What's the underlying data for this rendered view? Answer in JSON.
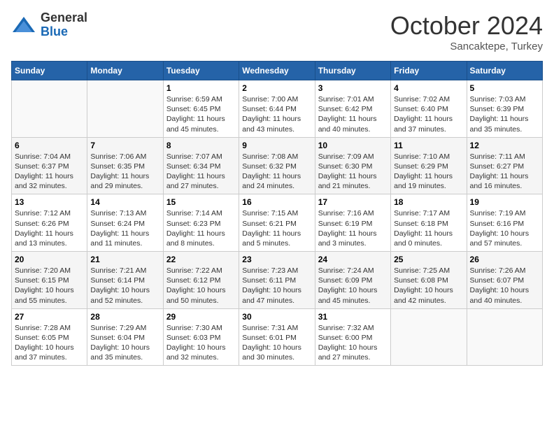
{
  "header": {
    "logo_general": "General",
    "logo_blue": "Blue",
    "month_title": "October 2024",
    "location": "Sancaktepe, Turkey"
  },
  "weekdays": [
    "Sunday",
    "Monday",
    "Tuesday",
    "Wednesday",
    "Thursday",
    "Friday",
    "Saturday"
  ],
  "weeks": [
    [
      {
        "day": "",
        "info": ""
      },
      {
        "day": "",
        "info": ""
      },
      {
        "day": "1",
        "info": "Sunrise: 6:59 AM\nSunset: 6:45 PM\nDaylight: 11 hours and 45 minutes."
      },
      {
        "day": "2",
        "info": "Sunrise: 7:00 AM\nSunset: 6:44 PM\nDaylight: 11 hours and 43 minutes."
      },
      {
        "day": "3",
        "info": "Sunrise: 7:01 AM\nSunset: 6:42 PM\nDaylight: 11 hours and 40 minutes."
      },
      {
        "day": "4",
        "info": "Sunrise: 7:02 AM\nSunset: 6:40 PM\nDaylight: 11 hours and 37 minutes."
      },
      {
        "day": "5",
        "info": "Sunrise: 7:03 AM\nSunset: 6:39 PM\nDaylight: 11 hours and 35 minutes."
      }
    ],
    [
      {
        "day": "6",
        "info": "Sunrise: 7:04 AM\nSunset: 6:37 PM\nDaylight: 11 hours and 32 minutes."
      },
      {
        "day": "7",
        "info": "Sunrise: 7:06 AM\nSunset: 6:35 PM\nDaylight: 11 hours and 29 minutes."
      },
      {
        "day": "8",
        "info": "Sunrise: 7:07 AM\nSunset: 6:34 PM\nDaylight: 11 hours and 27 minutes."
      },
      {
        "day": "9",
        "info": "Sunrise: 7:08 AM\nSunset: 6:32 PM\nDaylight: 11 hours and 24 minutes."
      },
      {
        "day": "10",
        "info": "Sunrise: 7:09 AM\nSunset: 6:30 PM\nDaylight: 11 hours and 21 minutes."
      },
      {
        "day": "11",
        "info": "Sunrise: 7:10 AM\nSunset: 6:29 PM\nDaylight: 11 hours and 19 minutes."
      },
      {
        "day": "12",
        "info": "Sunrise: 7:11 AM\nSunset: 6:27 PM\nDaylight: 11 hours and 16 minutes."
      }
    ],
    [
      {
        "day": "13",
        "info": "Sunrise: 7:12 AM\nSunset: 6:26 PM\nDaylight: 11 hours and 13 minutes."
      },
      {
        "day": "14",
        "info": "Sunrise: 7:13 AM\nSunset: 6:24 PM\nDaylight: 11 hours and 11 minutes."
      },
      {
        "day": "15",
        "info": "Sunrise: 7:14 AM\nSunset: 6:23 PM\nDaylight: 11 hours and 8 minutes."
      },
      {
        "day": "16",
        "info": "Sunrise: 7:15 AM\nSunset: 6:21 PM\nDaylight: 11 hours and 5 minutes."
      },
      {
        "day": "17",
        "info": "Sunrise: 7:16 AM\nSunset: 6:19 PM\nDaylight: 11 hours and 3 minutes."
      },
      {
        "day": "18",
        "info": "Sunrise: 7:17 AM\nSunset: 6:18 PM\nDaylight: 11 hours and 0 minutes."
      },
      {
        "day": "19",
        "info": "Sunrise: 7:19 AM\nSunset: 6:16 PM\nDaylight: 10 hours and 57 minutes."
      }
    ],
    [
      {
        "day": "20",
        "info": "Sunrise: 7:20 AM\nSunset: 6:15 PM\nDaylight: 10 hours and 55 minutes."
      },
      {
        "day": "21",
        "info": "Sunrise: 7:21 AM\nSunset: 6:14 PM\nDaylight: 10 hours and 52 minutes."
      },
      {
        "day": "22",
        "info": "Sunrise: 7:22 AM\nSunset: 6:12 PM\nDaylight: 10 hours and 50 minutes."
      },
      {
        "day": "23",
        "info": "Sunrise: 7:23 AM\nSunset: 6:11 PM\nDaylight: 10 hours and 47 minutes."
      },
      {
        "day": "24",
        "info": "Sunrise: 7:24 AM\nSunset: 6:09 PM\nDaylight: 10 hours and 45 minutes."
      },
      {
        "day": "25",
        "info": "Sunrise: 7:25 AM\nSunset: 6:08 PM\nDaylight: 10 hours and 42 minutes."
      },
      {
        "day": "26",
        "info": "Sunrise: 7:26 AM\nSunset: 6:07 PM\nDaylight: 10 hours and 40 minutes."
      }
    ],
    [
      {
        "day": "27",
        "info": "Sunrise: 7:28 AM\nSunset: 6:05 PM\nDaylight: 10 hours and 37 minutes."
      },
      {
        "day": "28",
        "info": "Sunrise: 7:29 AM\nSunset: 6:04 PM\nDaylight: 10 hours and 35 minutes."
      },
      {
        "day": "29",
        "info": "Sunrise: 7:30 AM\nSunset: 6:03 PM\nDaylight: 10 hours and 32 minutes."
      },
      {
        "day": "30",
        "info": "Sunrise: 7:31 AM\nSunset: 6:01 PM\nDaylight: 10 hours and 30 minutes."
      },
      {
        "day": "31",
        "info": "Sunrise: 7:32 AM\nSunset: 6:00 PM\nDaylight: 10 hours and 27 minutes."
      },
      {
        "day": "",
        "info": ""
      },
      {
        "day": "",
        "info": ""
      }
    ]
  ]
}
